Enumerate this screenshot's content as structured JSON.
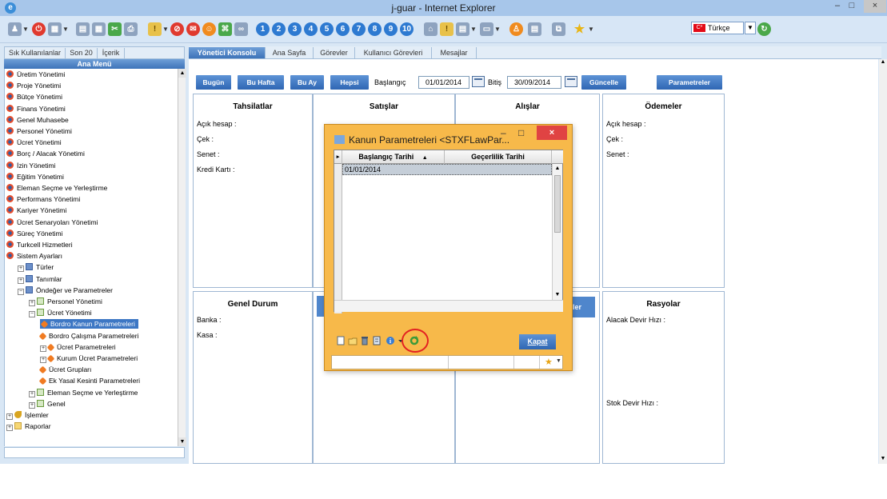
{
  "window": {
    "title": "j-guar - Internet Explorer",
    "minimize": "–",
    "maximize": "□",
    "close": "×"
  },
  "toolbar": {
    "numbers": [
      "1",
      "2",
      "3",
      "4",
      "5",
      "6",
      "7",
      "8",
      "9",
      "10"
    ],
    "language": "Türkçe",
    "lang_flag": "C*"
  },
  "left": {
    "tabs": [
      "Sık Kullanılanlar",
      "Son 20",
      "İçerik"
    ],
    "header": "Ana Menü",
    "tree": [
      {
        "label": "Üretim Yönetimi",
        "icon": "module-icon",
        "indent": 0
      },
      {
        "label": "Proje Yönetimi",
        "icon": "module-icon",
        "indent": 0
      },
      {
        "label": "Bütçe Yönetimi",
        "icon": "module-icon",
        "indent": 0
      },
      {
        "label": "Finans Yönetimi",
        "icon": "module-icon",
        "indent": 0
      },
      {
        "label": "Genel Muhasebe",
        "icon": "module-icon",
        "indent": 0
      },
      {
        "label": "Personel Yönetimi",
        "icon": "module-icon",
        "indent": 0
      },
      {
        "label": "Ücret Yönetimi",
        "icon": "module-icon",
        "indent": 0
      },
      {
        "label": "Borç / Alacak Yönetimi",
        "icon": "module-icon",
        "indent": 0
      },
      {
        "label": "İzin Yönetimi",
        "icon": "module-icon",
        "indent": 0
      },
      {
        "label": "Eğitim Yönetimi",
        "icon": "module-icon",
        "indent": 0
      },
      {
        "label": "Eleman Seçme ve Yerleştirme",
        "icon": "module-icon",
        "indent": 0
      },
      {
        "label": "Performans Yönetimi",
        "icon": "module-icon",
        "indent": 0
      },
      {
        "label": "Kariyer Yönetimi",
        "icon": "module-icon",
        "indent": 0
      },
      {
        "label": "Ücret Senaryoları Yönetimi",
        "icon": "module-icon",
        "indent": 0
      },
      {
        "label": "Süreç Yönetimi",
        "icon": "module-icon",
        "indent": 0
      },
      {
        "label": "Turkcell Hizmetleri",
        "icon": "module-icon",
        "indent": 0
      },
      {
        "label": "Sistem Ayarları",
        "icon": "module-icon",
        "indent": 0
      },
      {
        "label": "Türler",
        "icon": "folder-icon",
        "indent": 1,
        "exp": "+"
      },
      {
        "label": "Tanımlar",
        "icon": "folder-icon",
        "indent": 1,
        "exp": "+"
      },
      {
        "label": "Öndeğer ve Parametreler",
        "icon": "folder-icon",
        "indent": 1,
        "exp": "−"
      },
      {
        "label": "Personel Yönetimi",
        "icon": "table-icon",
        "indent": 2,
        "exp": "+"
      },
      {
        "label": "Ücret Yönetimi",
        "icon": "table-icon",
        "indent": 2,
        "exp": "−"
      },
      {
        "label": "Bordro Kanun Parametreleri",
        "icon": "gear-icon",
        "indent": 3,
        "sel": true
      },
      {
        "label": "Bordro Çalışma Parametreleri",
        "icon": "gear-icon",
        "indent": 3
      },
      {
        "label": "Ücret Parametreleri",
        "icon": "gear-icon",
        "indent": 3,
        "exp": "+"
      },
      {
        "label": "Kurum Ücret Parametreleri",
        "icon": "gear-icon",
        "indent": 3,
        "exp": "+"
      },
      {
        "label": "Ücret Grupları",
        "icon": "gear-icon",
        "indent": 3
      },
      {
        "label": "Ek Yasal Kesinti Parametreleri",
        "icon": "gear-icon",
        "indent": 3
      },
      {
        "label": "Eleman Seçme ve Yerleştirme",
        "icon": "table-icon",
        "indent": 2,
        "exp": "+"
      },
      {
        "label": "Genel",
        "icon": "table-icon",
        "indent": 2,
        "exp": "+"
      },
      {
        "label": "İşlemler",
        "icon": "key-icon",
        "indent": 0,
        "exp": "+"
      },
      {
        "label": "Raporlar",
        "icon": "folder-open-icon",
        "indent": 0,
        "exp": "+"
      }
    ]
  },
  "main": {
    "tabs": [
      "Yönetici Konsolu",
      "Ana Sayfa",
      "Görevler",
      "Kullanıcı Görevleri",
      "Mesajlar"
    ],
    "filter": {
      "today": "Bugün",
      "this_week": "Bu Hafta",
      "this_month": "Bu Ay",
      "all": "Hepsi",
      "start_label": "Başlangıç",
      "start_value": "01/01/2014",
      "end_label": "Bitiş",
      "end_value": "30/09/2014",
      "update": "Güncelle",
      "params": "Parametreler"
    },
    "panels": {
      "tahsilatlar": {
        "title": "Tahsilatlar",
        "rows": [
          "Açık hesap :",
          "Çek :",
          "Senet :",
          "Kredi Kartı :"
        ]
      },
      "satislar": {
        "title": "Satışlar"
      },
      "alislar": {
        "title": "Alışlar"
      },
      "odemeler": {
        "title": "Ödemeler",
        "rows": [
          "Açık hesap :",
          "Çek :",
          "Senet :"
        ]
      },
      "genel_durum": {
        "title": "Genel Durum",
        "rows": [
          "Banka :",
          "Kasa :"
        ]
      },
      "rasyolar": {
        "title": "Rasyolar",
        "rows": [
          "Alacak Devir Hızı :",
          "Stok Devir Hızı :"
        ]
      },
      "hidden_fragment": "ler"
    }
  },
  "modal": {
    "title": "Kanun Parametreleri <STXFLawPar...",
    "columns": [
      "Başlangıç Tarihi",
      "Geçerlilik Tarihi"
    ],
    "rows": [
      [
        "01/01/2014",
        ""
      ]
    ],
    "close_label": "Kapat"
  }
}
